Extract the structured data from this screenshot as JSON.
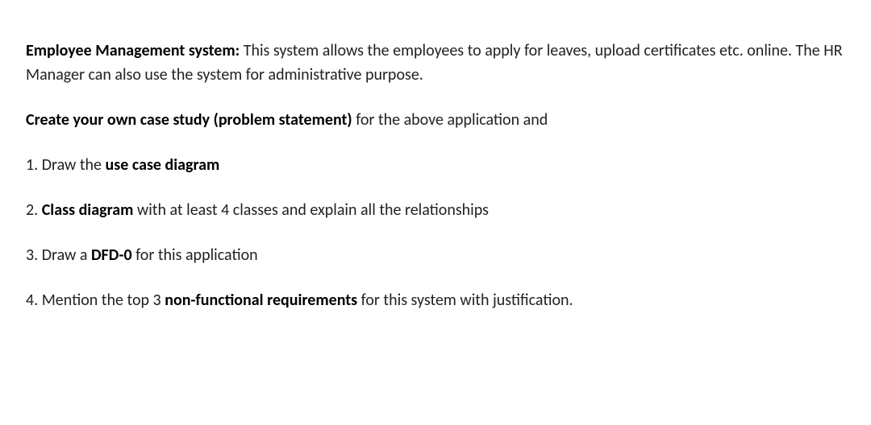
{
  "intro": {
    "title": "Employee Management system:",
    "description": " This system allows the employees to apply for leaves, upload certificates etc. online. The HR Manager can also use the system for administrative purpose."
  },
  "instruction": {
    "bold": "Create your own case study (problem statement)",
    "rest": " for the above application and"
  },
  "items": [
    {
      "prefix": "1. Draw the ",
      "bold": "use case diagram",
      "suffix": ""
    },
    {
      "prefix": "2. ",
      "bold": "Class diagram",
      "suffix": " with at least 4 classes and explain all the relationships"
    },
    {
      "prefix": "3. Draw a ",
      "bold": "DFD-0",
      "suffix": " for this application"
    },
    {
      "prefix": "4. Mention the top 3 ",
      "bold": "non-functional requirements",
      "suffix": " for this system with justification."
    }
  ]
}
